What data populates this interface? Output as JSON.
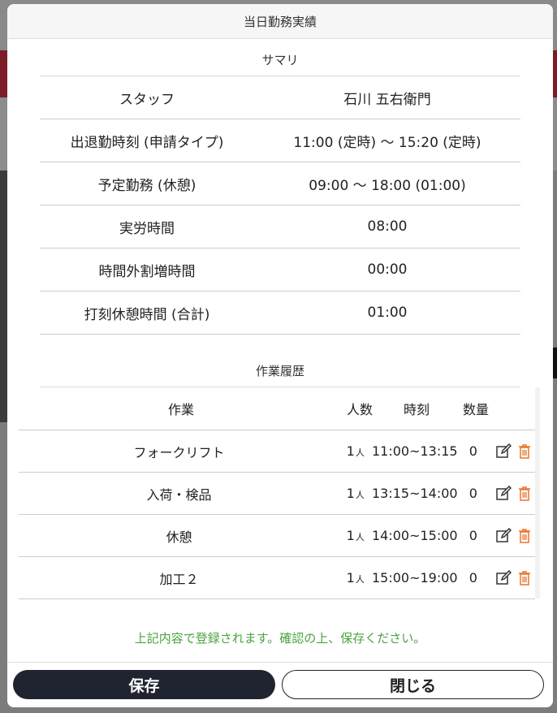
{
  "modal": {
    "title": "当日勤務実績"
  },
  "summary": {
    "title": "サマリ",
    "rows": [
      {
        "label": "スタッフ",
        "value": "石川 五右衛門"
      },
      {
        "label": "出退勤時刻 (申請タイプ)",
        "value": "11:00 (定時) 〜 15:20 (定時)"
      },
      {
        "label": "予定勤務 (休憩)",
        "value": "09:00 〜 18:00 (01:00)"
      },
      {
        "label": "実労時間",
        "value": "08:00"
      },
      {
        "label": "時間外割増時間",
        "value": "00:00"
      },
      {
        "label": "打刻休憩時間 (合計)",
        "value": "01:00"
      }
    ]
  },
  "history": {
    "title": "作業履歴",
    "columns": {
      "task": "作業",
      "people": "人数",
      "time": "時刻",
      "qty": "数量"
    },
    "unit_people": "人",
    "rows": [
      {
        "task": "フォークリフト",
        "people": "1",
        "time": "11:00~13:15",
        "qty": "0"
      },
      {
        "task": "入荷・検品",
        "people": "1",
        "time": "13:15~14:00",
        "qty": "0"
      },
      {
        "task": "休憩",
        "people": "1",
        "time": "14:00~15:00",
        "qty": "0"
      },
      {
        "task": "加工２",
        "people": "1",
        "time": "15:00~19:00",
        "qty": "0"
      }
    ]
  },
  "notice": "上記内容で登録されます。確認の上、保存ください。",
  "buttons": {
    "save": "保存",
    "close": "閉じる"
  },
  "colors": {
    "save_bg": "#1f2430",
    "notice": "#4aa33f",
    "delete_icon": "#e8762b",
    "edit_icon": "#333333"
  },
  "icons": {
    "edit": "edit-icon",
    "delete": "trash-icon"
  }
}
